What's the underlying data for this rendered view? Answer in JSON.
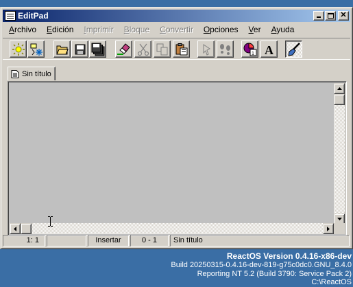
{
  "window": {
    "title": "EditPad",
    "controls": {
      "minimize": "minimize",
      "maximize": "maximize",
      "close": "✕"
    }
  },
  "menubar": {
    "items": [
      {
        "label": "Archivo",
        "enabled": true
      },
      {
        "label": "Edición",
        "enabled": true
      },
      {
        "label": "Imprimir",
        "enabled": false
      },
      {
        "label": "Bloque",
        "enabled": false
      },
      {
        "label": "Convertir",
        "enabled": false
      },
      {
        "label": "Opciones",
        "enabled": true
      },
      {
        "label": "Ver",
        "enabled": true
      },
      {
        "label": "Ayuda",
        "enabled": true
      }
    ]
  },
  "toolbar": {
    "buttons": [
      {
        "icon": "new-sun-icon",
        "enabled": true
      },
      {
        "icon": "new-snowflake-icon",
        "enabled": true
      },
      {
        "icon": "open-folder-icon",
        "enabled": true
      },
      {
        "icon": "save-disk-icon",
        "enabled": true
      },
      {
        "icon": "save-all-disks-icon",
        "enabled": true
      },
      {
        "icon": "eraser-icon",
        "enabled": true
      },
      {
        "icon": "cut-scissors-icon",
        "enabled": false
      },
      {
        "icon": "copy-icon",
        "enabled": false
      },
      {
        "icon": "paste-clipboard-icon",
        "enabled": true
      },
      {
        "icon": "mark-pin-icon",
        "enabled": false
      },
      {
        "icon": "footsteps-icon",
        "enabled": false
      },
      {
        "icon": "statistics-pie-icon",
        "enabled": true
      },
      {
        "icon": "font-letter-a-icon",
        "enabled": true
      },
      {
        "icon": "word-wrap-brush-icon",
        "enabled": true,
        "pressed": true
      }
    ]
  },
  "tabs": [
    {
      "label": "Sin título",
      "active": true
    }
  ],
  "editor": {
    "content": ""
  },
  "statusbar": {
    "position": "1: 1",
    "panel2": "",
    "mode": "Insertar",
    "selection": "0 - 1",
    "filename": "Sin título"
  },
  "desktop": {
    "version": "ReactOS Version 0.4.16-x86-dev",
    "build": "Build 20250315-0.4.16-dev-819-g75c0dc0.GNU_8.4.0",
    "reporting": "Reporting NT 5.2 (Build 3790: Service Pack 2)",
    "path": "C:\\ReactOS"
  },
  "colors": {
    "desktop": "#3a6ea5",
    "face": "#d4d0c8",
    "titlebar_start": "#0a246a",
    "titlebar_end": "#a6caf0",
    "editor_bg": "#c0c0c0"
  }
}
